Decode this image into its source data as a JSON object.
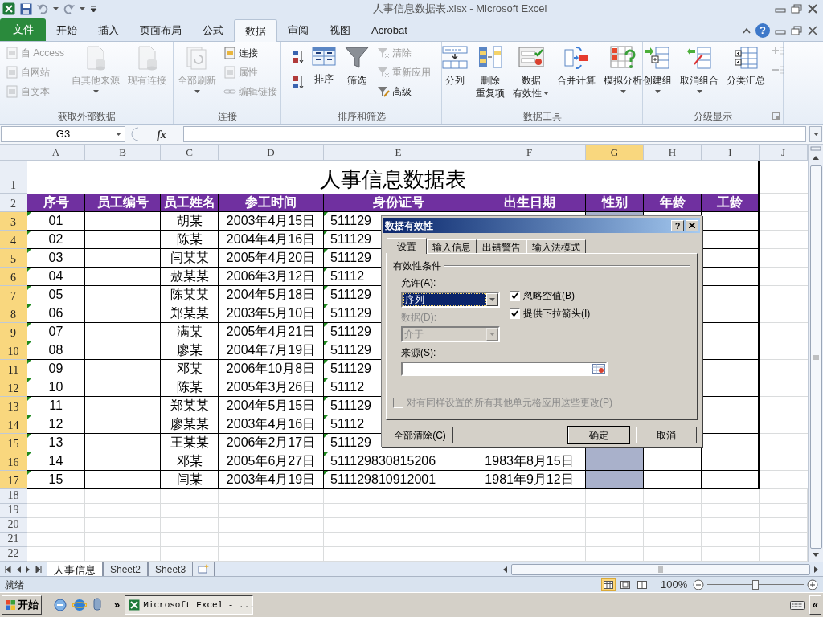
{
  "window": {
    "title": "人事信息数据表.xlsx - Microsoft Excel"
  },
  "ribbon_tabs": [
    {
      "label": "文件",
      "kind": "file",
      "selected": false
    },
    {
      "label": "开始",
      "kind": "tab",
      "selected": false
    },
    {
      "label": "插入",
      "kind": "tab",
      "selected": false
    },
    {
      "label": "页面布局",
      "kind": "tab",
      "selected": false
    },
    {
      "label": "公式",
      "kind": "tab",
      "selected": false
    },
    {
      "label": "数据",
      "kind": "tab",
      "selected": true
    },
    {
      "label": "审阅",
      "kind": "tab",
      "selected": false
    },
    {
      "label": "视图",
      "kind": "tab",
      "selected": false
    },
    {
      "label": "Acrobat",
      "kind": "tab",
      "selected": false
    }
  ],
  "ribbon_help": "?",
  "ribbon_groups": [
    {
      "label": "获取外部数据",
      "items": [
        {
          "kind": "stack",
          "items": [
            {
              "label": "自 Access",
              "disabled": true
            },
            {
              "label": "自网站",
              "disabled": true
            },
            {
              "label": "自文本",
              "disabled": true
            }
          ]
        },
        {
          "kind": "large",
          "lines": [
            "自其他来源"
          ],
          "dropdown": true,
          "disabled": true
        },
        {
          "kind": "large",
          "lines": [
            "现有连接"
          ],
          "dropdown": false,
          "disabled": true
        }
      ]
    },
    {
      "label": "连接",
      "items": [
        {
          "kind": "large",
          "lines": [
            "全部刷新"
          ],
          "dropdown": true,
          "disabled": true
        },
        {
          "kind": "stack",
          "items": [
            {
              "label": "连接",
              "disabled": false
            },
            {
              "label": "属性",
              "disabled": true
            },
            {
              "label": "编辑链接",
              "disabled": true
            }
          ]
        }
      ]
    },
    {
      "label": "排序和筛选",
      "items": [
        {
          "kind": "sort_icons"
        },
        {
          "kind": "large",
          "lines": [
            "排序"
          ],
          "dropdown": false,
          "disabled": false
        },
        {
          "kind": "large",
          "lines": [
            "筛选"
          ],
          "dropdown": false,
          "disabled": false
        },
        {
          "kind": "stack",
          "items": [
            {
              "label": "清除",
              "disabled": true
            },
            {
              "label": "重新应用",
              "disabled": true
            },
            {
              "label": "高级",
              "disabled": false
            }
          ]
        }
      ]
    },
    {
      "label": "数据工具",
      "items": [
        {
          "kind": "large",
          "lines": [
            "分列"
          ],
          "dropdown": false,
          "disabled": false
        },
        {
          "kind": "large",
          "lines": [
            "删除",
            "重复项"
          ],
          "dropdown": false,
          "disabled": false
        },
        {
          "kind": "large",
          "lines": [
            "数据",
            "有效性"
          ],
          "dropdown": true,
          "disabled": false
        },
        {
          "kind": "large",
          "lines": [
            "合并计算"
          ],
          "dropdown": false,
          "disabled": false
        },
        {
          "kind": "large",
          "lines": [
            "模拟分析"
          ],
          "dropdown": true,
          "disabled": false
        }
      ]
    },
    {
      "label": "分级显示",
      "launcher": true,
      "items": [
        {
          "kind": "large",
          "lines": [
            "创建组"
          ],
          "dropdown": true,
          "disabled": false
        },
        {
          "kind": "large",
          "lines": [
            "取消组合"
          ],
          "dropdown": true,
          "disabled": false
        },
        {
          "kind": "large",
          "lines": [
            "分类汇总"
          ],
          "dropdown": false,
          "disabled": false
        },
        {
          "kind": "detail_icons",
          "disabled": true
        }
      ]
    }
  ],
  "formula_bar": {
    "name_box": "G3",
    "function_label": "fx"
  },
  "sheet": {
    "columns": [
      {
        "label": "A",
        "selected": false
      },
      {
        "label": "B",
        "selected": false
      },
      {
        "label": "C",
        "selected": false
      },
      {
        "label": "D",
        "selected": false
      },
      {
        "label": "E",
        "selected": false
      },
      {
        "label": "F",
        "selected": false
      },
      {
        "label": "G",
        "selected": true
      },
      {
        "label": "H",
        "selected": false
      },
      {
        "label": "I",
        "selected": false
      },
      {
        "label": "J",
        "selected": false
      }
    ],
    "title_row": "1",
    "title": "人事信息数据表",
    "header_row": "2",
    "headers": [
      "序号",
      "员工编号",
      "员工姓名",
      "参工时间",
      "身份证号",
      "出生日期",
      "性别",
      "年龄",
      "工龄"
    ],
    "data_rows": [
      {
        "row": "3",
        "selected": true,
        "flagged": true,
        "number": "01",
        "name": "胡某",
        "start_date": "2003年4月15日",
        "id_number": "511129"
      },
      {
        "row": "4",
        "selected": true,
        "flagged": true,
        "number": "02",
        "name": "陈某",
        "start_date": "2004年4月16日",
        "id_number": "511129"
      },
      {
        "row": "5",
        "selected": true,
        "flagged": true,
        "number": "03",
        "name": "闫某某",
        "start_date": "2005年4月20日",
        "id_number": "511129"
      },
      {
        "row": "6",
        "selected": true,
        "flagged": true,
        "number": "04",
        "name": "敖某某",
        "start_date": "2006年3月12日",
        "id_number": "51112"
      },
      {
        "row": "7",
        "selected": true,
        "flagged": true,
        "number": "05",
        "name": "陈某某",
        "start_date": "2004年5月18日",
        "id_number": "511129"
      },
      {
        "row": "8",
        "selected": true,
        "flagged": true,
        "number": "06",
        "name": "郑某某",
        "start_date": "2003年5月10日",
        "id_number": "511129"
      },
      {
        "row": "9",
        "selected": true,
        "flagged": true,
        "number": "07",
        "name": "满某",
        "start_date": "2005年4月21日",
        "id_number": "511129"
      },
      {
        "row": "10",
        "selected": true,
        "flagged": true,
        "number": "08",
        "name": "廖某",
        "start_date": "2004年7月19日",
        "id_number": "511129"
      },
      {
        "row": "11",
        "selected": true,
        "flagged": true,
        "number": "09",
        "name": "邓某",
        "start_date": "2006年10月8日",
        "id_number": "511129"
      },
      {
        "row": "12",
        "selected": true,
        "flagged": true,
        "number": "10",
        "name": "陈某",
        "start_date": "2005年3月26日",
        "id_number": "51112"
      },
      {
        "row": "13",
        "selected": true,
        "flagged": true,
        "number": "11",
        "name": "郑某某",
        "start_date": "2004年5月15日",
        "id_number": "511129"
      },
      {
        "row": "14",
        "selected": true,
        "flagged": true,
        "number": "12",
        "name": "廖某某",
        "start_date": "2003年4月16日",
        "id_number": "51112"
      },
      {
        "row": "15",
        "selected": true,
        "flagged": true,
        "number": "13",
        "name": "王某某",
        "start_date": "2006年2月17日",
        "id_number": "511129"
      },
      {
        "row": "16",
        "selected": true,
        "flagged": true,
        "number": "14",
        "name": "邓某",
        "start_date": "2005年6月27日",
        "id_number": "511129830815206",
        "birth_date": "1983年8月15日"
      },
      {
        "row": "17",
        "selected": true,
        "flagged": true,
        "number": "15",
        "name": "闫某",
        "start_date": "2003年4月19日",
        "id_number": "511129810912001",
        "birth_date": "1981年9月12日"
      }
    ],
    "empty_rows": [
      "18",
      "19",
      "20",
      "21",
      "22"
    ]
  },
  "dialog": {
    "title": "数据有效性",
    "help": "?",
    "tabs": [
      {
        "label": "设置",
        "selected": true
      },
      {
        "label": "输入信息",
        "selected": false
      },
      {
        "label": "出错警告",
        "selected": false
      },
      {
        "label": "输入法模式",
        "selected": false
      }
    ],
    "group_label": "有效性条件",
    "allow": {
      "label": "允许(A):",
      "value": "序列"
    },
    "checkboxes": [
      {
        "label": "忽略空值(B)",
        "checked": true
      },
      {
        "label": "提供下拉箭头(I)",
        "checked": true
      }
    ],
    "data": {
      "label": "数据(D):",
      "value": "介于",
      "disabled": true
    },
    "source": {
      "label": "来源(S):"
    },
    "apply_all": {
      "label": "对有同样设置的所有其他单元格应用这些更改(P)",
      "checked": false,
      "disabled": true
    },
    "buttons": [
      {
        "label": "全部清除(C)",
        "default": false
      },
      {
        "label": "确定",
        "default": true
      },
      {
        "label": "取消",
        "default": false
      }
    ]
  },
  "sheet_tabs": [
    {
      "label": "人事信息",
      "selected": true
    },
    {
      "label": "Sheet2",
      "selected": false
    },
    {
      "label": "Sheet3",
      "selected": false
    }
  ],
  "status_bar": {
    "text": "就绪",
    "views": [
      {
        "selected": true
      },
      {
        "selected": false
      },
      {
        "selected": false
      }
    ],
    "zoom": "100%",
    "zoom_slider": {
      "level": 0.5
    }
  },
  "taskbar": {
    "start": "开始",
    "more": "»",
    "tasks": [
      {
        "label": "Microsoft Excel - ...",
        "selected": true
      }
    ],
    "collapse": "«"
  }
}
